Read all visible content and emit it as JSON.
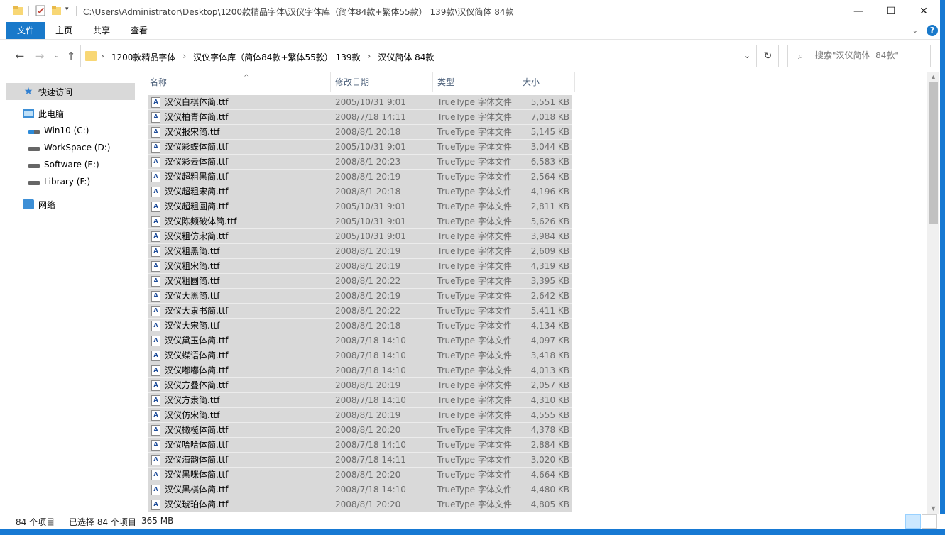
{
  "window": {
    "title": "C:\\Users\\Administrator\\Desktop\\1200款精品字体\\汉仪字体库（简体84款+繁体55款） 139款\\汉仪简体  84款",
    "minimize": "—",
    "maximize": "☐",
    "close": "✕"
  },
  "ribbon": {
    "tabs": [
      "文件",
      "主页",
      "共享",
      "查看"
    ],
    "help": "?"
  },
  "address": {
    "crumbs": [
      "1200款精品字体",
      "汉仪字体库（简体84款+繁体55款） 139款",
      "汉仪简体  84款"
    ],
    "separator": "›",
    "search_placeholder": "搜索\"汉仪简体  84款\""
  },
  "sidebar": {
    "quick_access": "快速访问",
    "this_pc": "此电脑",
    "drives": [
      "Win10 (C:)",
      "WorkSpace (D:)",
      "Software (E:)",
      "Library (F:)"
    ],
    "network": "网络"
  },
  "columns": {
    "name": "名称",
    "date": "修改日期",
    "type": "类型",
    "size": "大小"
  },
  "files": [
    {
      "name": "汉仪白棋体简.ttf",
      "date": "2005/10/31 9:01",
      "type": "TrueType 字体文件",
      "size": "5,551 KB"
    },
    {
      "name": "汉仪柏青体简.ttf",
      "date": "2008/7/18 14:11",
      "type": "TrueType 字体文件",
      "size": "7,018 KB"
    },
    {
      "name": "汉仪报宋简.ttf",
      "date": "2008/8/1 20:18",
      "type": "TrueType 字体文件",
      "size": "5,145 KB"
    },
    {
      "name": "汉仪彩蝶体简.ttf",
      "date": "2005/10/31 9:01",
      "type": "TrueType 字体文件",
      "size": "3,044 KB"
    },
    {
      "name": "汉仪彩云体简.ttf",
      "date": "2008/8/1 20:23",
      "type": "TrueType 字体文件",
      "size": "6,583 KB"
    },
    {
      "name": "汉仪超粗黑简.ttf",
      "date": "2008/8/1 20:19",
      "type": "TrueType 字体文件",
      "size": "2,564 KB"
    },
    {
      "name": "汉仪超粗宋简.ttf",
      "date": "2008/8/1 20:18",
      "type": "TrueType 字体文件",
      "size": "4,196 KB"
    },
    {
      "name": "汉仪超粗圆简.ttf",
      "date": "2005/10/31 9:01",
      "type": "TrueType 字体文件",
      "size": "2,811 KB"
    },
    {
      "name": "汉仪陈频破体简.ttf",
      "date": "2005/10/31 9:01",
      "type": "TrueType 字体文件",
      "size": "5,626 KB"
    },
    {
      "name": "汉仪粗仿宋简.ttf",
      "date": "2005/10/31 9:01",
      "type": "TrueType 字体文件",
      "size": "3,984 KB"
    },
    {
      "name": "汉仪粗黑简.ttf",
      "date": "2008/8/1 20:19",
      "type": "TrueType 字体文件",
      "size": "2,609 KB"
    },
    {
      "name": "汉仪粗宋简.ttf",
      "date": "2008/8/1 20:19",
      "type": "TrueType 字体文件",
      "size": "4,319 KB"
    },
    {
      "name": "汉仪粗圆简.ttf",
      "date": "2008/8/1 20:22",
      "type": "TrueType 字体文件",
      "size": "3,395 KB"
    },
    {
      "name": "汉仪大黑简.ttf",
      "date": "2008/8/1 20:19",
      "type": "TrueType 字体文件",
      "size": "2,642 KB"
    },
    {
      "name": "汉仪大隶书简.ttf",
      "date": "2008/8/1 20:22",
      "type": "TrueType 字体文件",
      "size": "5,411 KB"
    },
    {
      "name": "汉仪大宋简.ttf",
      "date": "2008/8/1 20:18",
      "type": "TrueType 字体文件",
      "size": "4,134 KB"
    },
    {
      "name": "汉仪黛玉体简.ttf",
      "date": "2008/7/18 14:10",
      "type": "TrueType 字体文件",
      "size": "4,097 KB"
    },
    {
      "name": "汉仪蝶语体简.ttf",
      "date": "2008/7/18 14:10",
      "type": "TrueType 字体文件",
      "size": "3,418 KB"
    },
    {
      "name": "汉仪嘟嘟体简.ttf",
      "date": "2008/7/18 14:10",
      "type": "TrueType 字体文件",
      "size": "4,013 KB"
    },
    {
      "name": "汉仪方叠体简.ttf",
      "date": "2008/8/1 20:19",
      "type": "TrueType 字体文件",
      "size": "2,057 KB"
    },
    {
      "name": "汉仪方隶简.ttf",
      "date": "2008/7/18 14:10",
      "type": "TrueType 字体文件",
      "size": "4,310 KB"
    },
    {
      "name": "汉仪仿宋简.ttf",
      "date": "2008/8/1 20:19",
      "type": "TrueType 字体文件",
      "size": "4,555 KB"
    },
    {
      "name": "汉仪橄榄体简.ttf",
      "date": "2008/8/1 20:20",
      "type": "TrueType 字体文件",
      "size": "4,378 KB"
    },
    {
      "name": "汉仪哈哈体简.ttf",
      "date": "2008/7/18 14:10",
      "type": "TrueType 字体文件",
      "size": "2,884 KB"
    },
    {
      "name": "汉仪海韵体简.ttf",
      "date": "2008/7/18 14:11",
      "type": "TrueType 字体文件",
      "size": "3,020 KB"
    },
    {
      "name": "汉仪黑咪体简.ttf",
      "date": "2008/8/1 20:20",
      "type": "TrueType 字体文件",
      "size": "4,664 KB"
    },
    {
      "name": "汉仪黑棋体简.ttf",
      "date": "2008/7/18 14:10",
      "type": "TrueType 字体文件",
      "size": "4,480 KB"
    },
    {
      "name": "汉仪琥珀体简.ttf",
      "date": "2008/8/1 20:20",
      "type": "TrueType 字体文件",
      "size": "4,805 KB"
    }
  ],
  "status": {
    "count": "84 个项目",
    "selected": "已选择 84 个项目",
    "size": "365 MB"
  }
}
